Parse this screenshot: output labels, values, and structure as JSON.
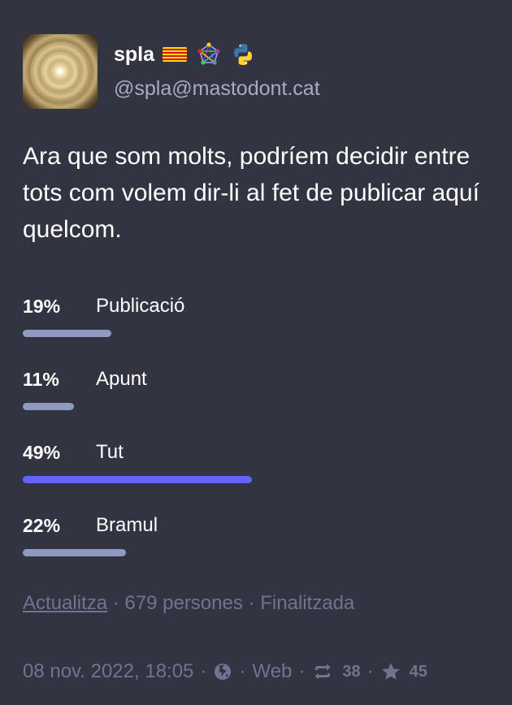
{
  "account": {
    "display_name": "spla",
    "handle": "@spla@mastodont.cat",
    "emojis": [
      "catalan-flag-icon",
      "fediverse-icon",
      "python-icon"
    ]
  },
  "status": {
    "text": "Ara que som molts, podríem decidir entre tots com volem dir-li al fet de publicar aquí quelcom."
  },
  "poll": {
    "options": [
      {
        "percent": "19%",
        "label": "Publicació",
        "fraction": 0.19,
        "leading": false
      },
      {
        "percent": "11%",
        "label": "Apunt",
        "fraction": 0.11,
        "leading": false
      },
      {
        "percent": "49%",
        "label": "Tut",
        "fraction": 0.49,
        "leading": true
      },
      {
        "percent": "22%",
        "label": "Bramul",
        "fraction": 0.22,
        "leading": false
      }
    ],
    "refresh_label": "Actualitza",
    "voters": "679 persones",
    "state": "Finalitzada",
    "separator": "·"
  },
  "meta": {
    "timestamp": "08 nov. 2022, 18:05",
    "visibility_icon": "globe-icon",
    "application": "Web",
    "boost_count": "38",
    "favourite_count": "45",
    "separator": "·"
  },
  "colors": {
    "background": "#323442",
    "bar": "#8e9ac0",
    "bar_leading": "#6364ff",
    "muted": "#6f7590",
    "handle": "#a6abc6"
  }
}
